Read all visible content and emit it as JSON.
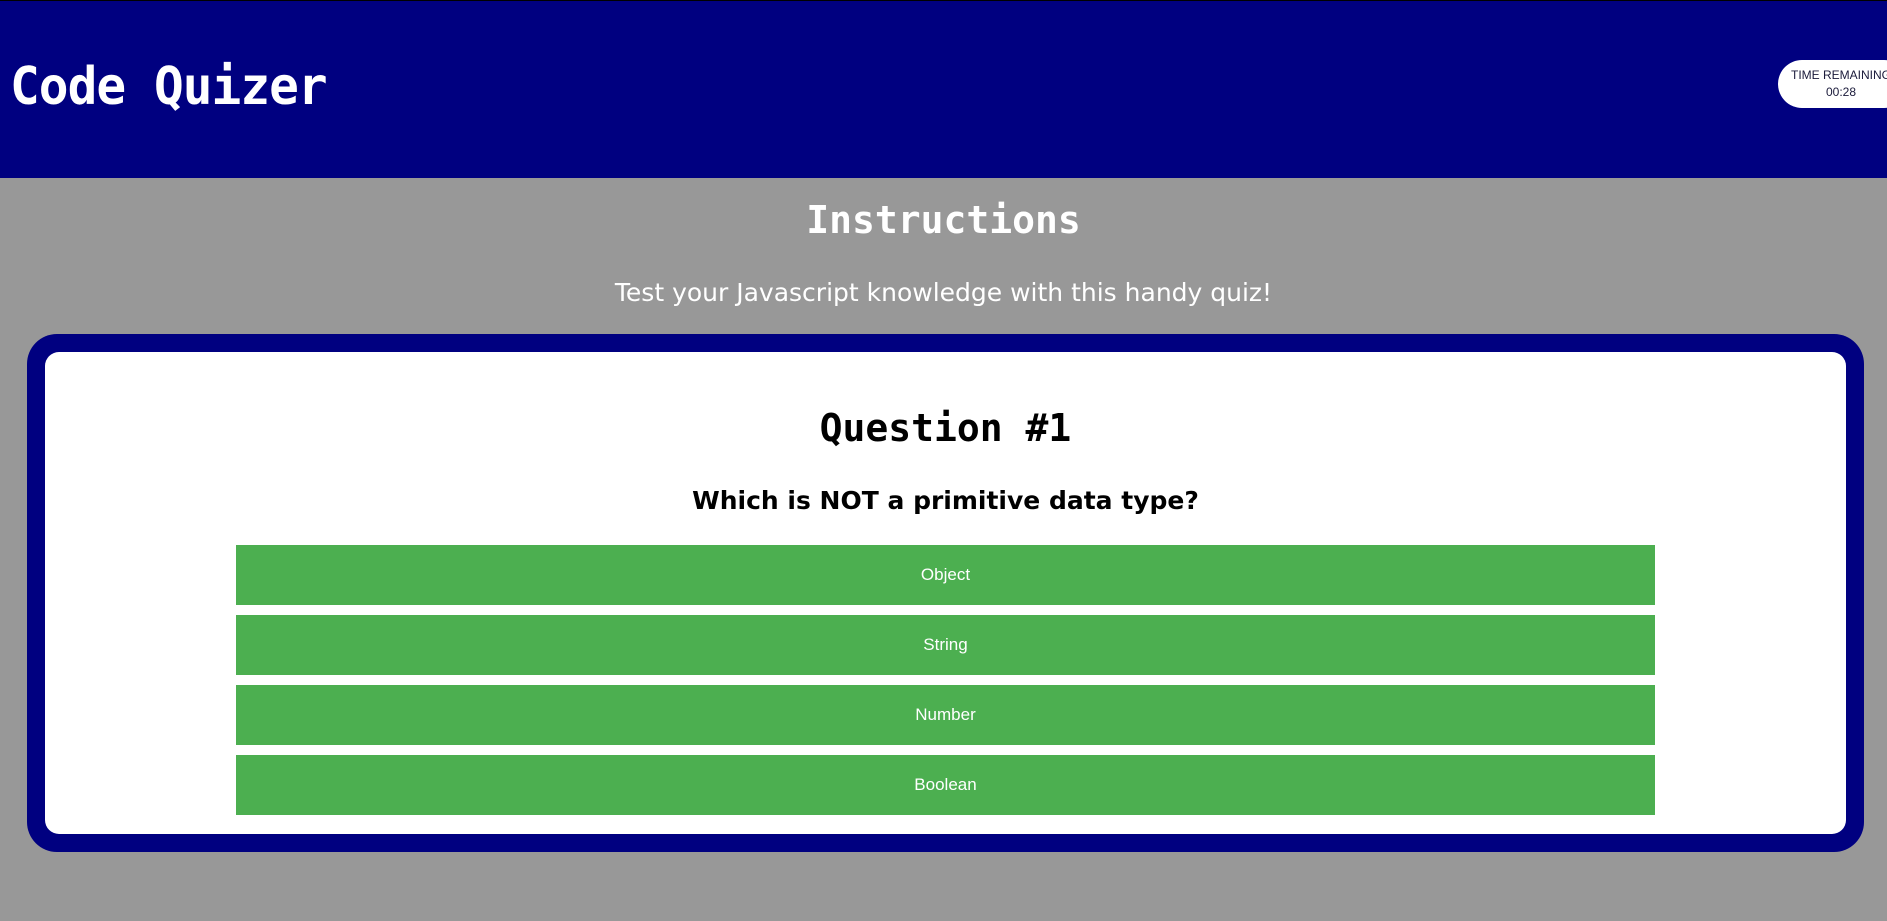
{
  "header": {
    "title": "Code Quizer",
    "timer": {
      "label": "TIME REMAINING",
      "value": "00:28"
    }
  },
  "instructions": {
    "title": "Instructions",
    "text": "Test your Javascript knowledge with this handy quiz!"
  },
  "quiz": {
    "question_number": "Question #1",
    "question_text": "Which is NOT a primitive data type?",
    "choices": [
      {
        "label": "Object"
      },
      {
        "label": "String"
      },
      {
        "label": "Number"
      },
      {
        "label": "Boolean"
      }
    ]
  },
  "colors": {
    "header_bg": "#000080",
    "page_bg": "#989898",
    "choice_bg": "#4caf50",
    "card_bg": "#ffffff"
  }
}
